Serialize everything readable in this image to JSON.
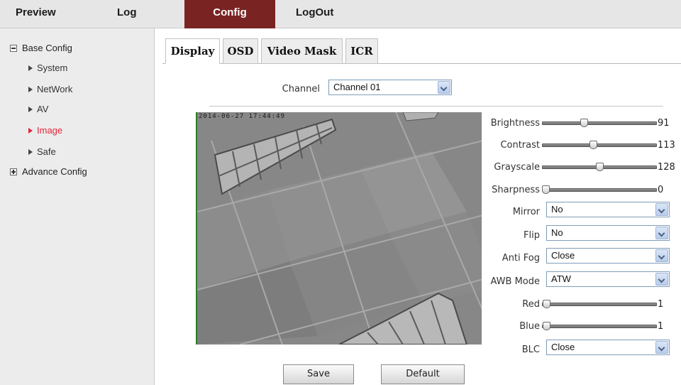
{
  "nav": {
    "preview": "Preview",
    "log": "Log",
    "config": "Config",
    "logout": "LogOut",
    "active_color": "#7a2323"
  },
  "sidebar": {
    "base_config": "Base Config",
    "items": [
      {
        "label": "System"
      },
      {
        "label": "NetWork"
      },
      {
        "label": "AV"
      },
      {
        "label": "Image"
      },
      {
        "label": "Safe"
      }
    ],
    "advance_config": "Advance Config",
    "active_item_color": "#e0263a"
  },
  "tabs": {
    "display": "Display",
    "osd": "OSD",
    "video_mask": "Video Mask",
    "icr": "ICR"
  },
  "channel": {
    "label": "Channel",
    "value": "Channel 01"
  },
  "video": {
    "timestamp": "2014-06-27  17:44:49"
  },
  "settings": {
    "brightness": {
      "label": "Brightness",
      "value": "91",
      "level": 91,
      "max": 255
    },
    "contrast": {
      "label": "Contrast",
      "value": "113",
      "level": 113,
      "max": 255
    },
    "grayscale": {
      "label": "Grayscale",
      "value": "128",
      "level": 128,
      "max": 255
    },
    "sharpness": {
      "label": "Sharpness",
      "value": "0",
      "level": 0,
      "max": 255
    },
    "mirror": {
      "label": "Mirror",
      "value": "No"
    },
    "flip": {
      "label": "Flip",
      "value": "No"
    },
    "anti_fog": {
      "label": "Anti Fog",
      "value": "Close"
    },
    "awb_mode": {
      "label": "AWB Mode",
      "value": "ATW"
    },
    "red": {
      "label": "Red",
      "value": "1",
      "level": 1,
      "max": 255
    },
    "blue": {
      "label": "Blue",
      "value": "1",
      "level": 1,
      "max": 255
    },
    "blc": {
      "label": "BLC",
      "value": "Close"
    }
  },
  "buttons": {
    "save": "Save",
    "default": "Default"
  }
}
